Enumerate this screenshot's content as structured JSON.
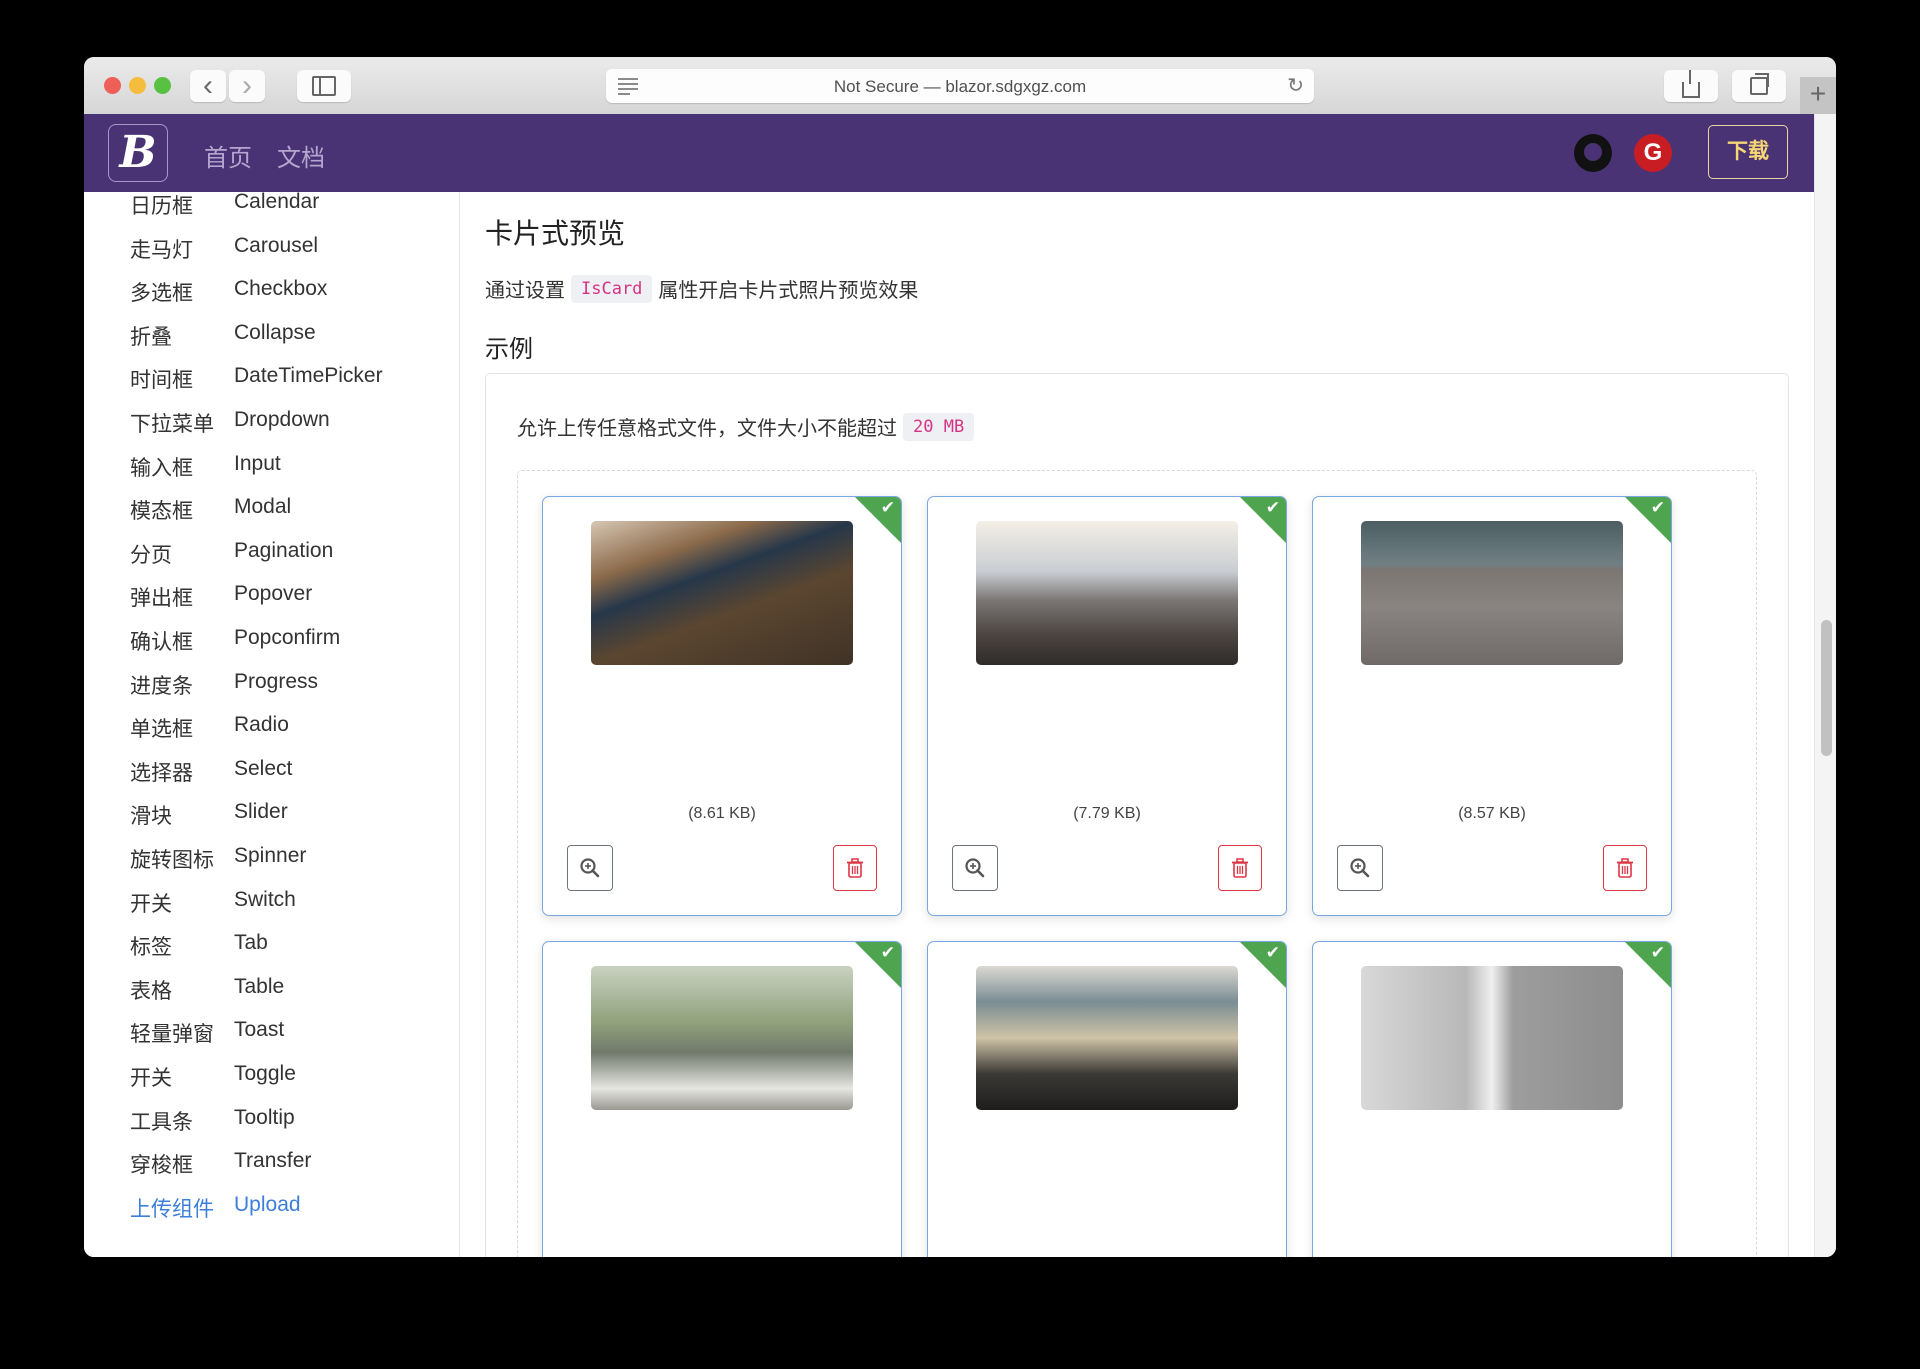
{
  "browser": {
    "url_text": "Not Secure — blazor.sdgxgz.com",
    "toolbar_icons": [
      "back-icon",
      "forward-icon",
      "sidebar-icon",
      "reader-icon",
      "reload-icon",
      "share-icon",
      "tabs-icon",
      "new-tab-icon"
    ],
    "back_glyph": "‹",
    "forward_glyph": "›",
    "reload_glyph": "↻",
    "new_tab_glyph": "+"
  },
  "navbar": {
    "logo_letter": "B",
    "links": [
      {
        "label": "首页"
      },
      {
        "label": "文档"
      }
    ],
    "gitee_glyph": "G",
    "download_label": "下载",
    "colors": {
      "background": "#4a3374",
      "download_text": "#f7d774"
    }
  },
  "sidebar": {
    "items": [
      {
        "zh": "日历框",
        "en": "Calendar"
      },
      {
        "zh": "走马灯",
        "en": "Carousel"
      },
      {
        "zh": "多选框",
        "en": "Checkbox"
      },
      {
        "zh": "折叠",
        "en": "Collapse"
      },
      {
        "zh": "时间框",
        "en": "DateTimePicker"
      },
      {
        "zh": "下拉菜单",
        "en": "Dropdown"
      },
      {
        "zh": "输入框",
        "en": "Input"
      },
      {
        "zh": "模态框",
        "en": "Modal"
      },
      {
        "zh": "分页",
        "en": "Pagination"
      },
      {
        "zh": "弹出框",
        "en": "Popover"
      },
      {
        "zh": "确认框",
        "en": "Popconfirm"
      },
      {
        "zh": "进度条",
        "en": "Progress"
      },
      {
        "zh": "单选框",
        "en": "Radio"
      },
      {
        "zh": "选择器",
        "en": "Select"
      },
      {
        "zh": "滑块",
        "en": "Slider"
      },
      {
        "zh": "旋转图标",
        "en": "Spinner"
      },
      {
        "zh": "开关",
        "en": "Switch"
      },
      {
        "zh": "标签",
        "en": "Tab"
      },
      {
        "zh": "表格",
        "en": "Table"
      },
      {
        "zh": "轻量弹窗",
        "en": "Toast"
      },
      {
        "zh": "开关",
        "en": "Toggle"
      },
      {
        "zh": "工具条",
        "en": "Tooltip"
      },
      {
        "zh": "穿梭框",
        "en": "Transfer"
      },
      {
        "zh": "上传组件",
        "en": "Upload",
        "active": true
      }
    ],
    "active_color": "#3c7fd8"
  },
  "main": {
    "title": "卡片式预览",
    "desc_before": "通过设置",
    "desc_code": "IsCard",
    "desc_after": "属性开启卡片式照片预览效果",
    "example_heading": "示例",
    "hint_text": "允许上传任意格式文件，文件大小不能超过",
    "hint_code": "20 MB",
    "cards": [
      {
        "image": "person-sitting-on-stool",
        "size": "(8.61 KB)",
        "status": "uploaded"
      },
      {
        "image": "mountain-above-clouds",
        "size": "(7.79 KB)",
        "status": "uploaded"
      },
      {
        "image": "bench-on-pier",
        "size": "(8.57 KB)",
        "status": "uploaded"
      },
      {
        "image": "plant-by-balcony",
        "size": "",
        "status": "uploaded"
      },
      {
        "image": "beach-with-rocks",
        "size": "",
        "status": "uploaded"
      },
      {
        "image": "statue-of-liberty",
        "size": "",
        "status": "uploaded"
      }
    ],
    "check_glyph": "✔",
    "colors": {
      "card_border": "#7aa7e3",
      "success": "#4ea44f",
      "delete": "#dc3545",
      "code": "#d63384"
    }
  }
}
